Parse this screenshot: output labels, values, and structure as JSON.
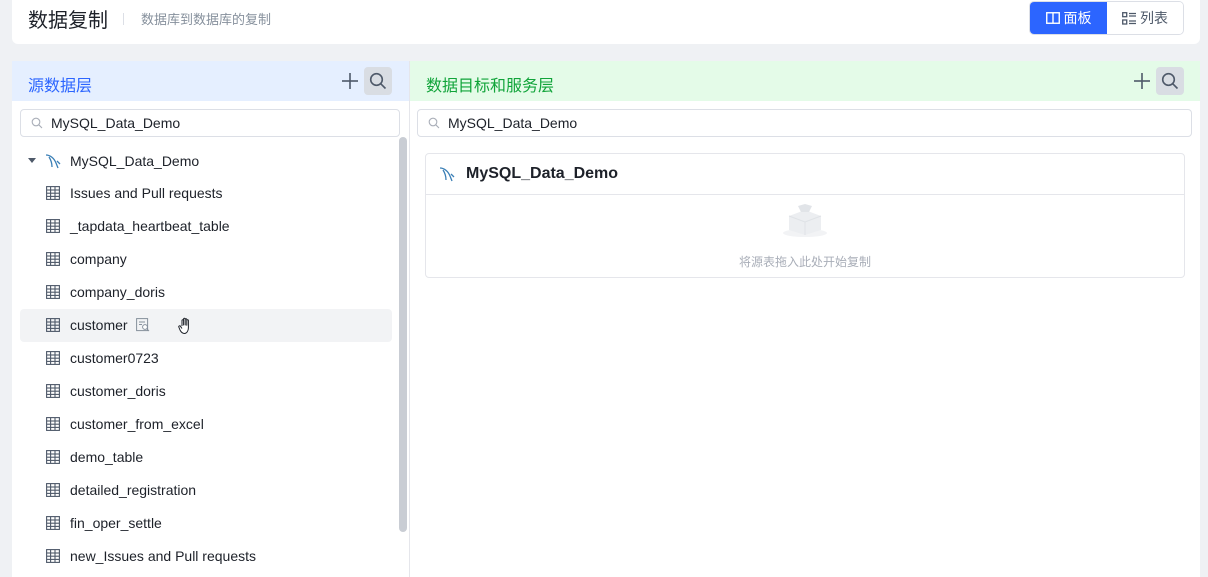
{
  "header": {
    "title": "数据复制",
    "subtitle": "数据库到数据库的复制",
    "view_panel_label": "面板",
    "view_list_label": "列表"
  },
  "source": {
    "title": "源数据层",
    "search_value": "MySQL_Data_Demo",
    "root_label": "MySQL_Data_Demo",
    "items": [
      "Issues and Pull requests",
      "_tapdata_heartbeat_table",
      "company",
      "company_doris",
      "customer",
      "customer0723",
      "customer_doris",
      "customer_from_excel",
      "demo_table",
      "detailed_registration",
      "fin_oper_settle",
      "new_Issues and Pull requests"
    ],
    "hover_index": 4
  },
  "target": {
    "title": "数据目标和服务层",
    "search_value": "MySQL_Data_Demo",
    "card_title": "MySQL_Data_Demo",
    "empty_text": "将源表拖入此处开始复制"
  },
  "colors": {
    "accent": "#2c65ff",
    "source_header_bg": "#e5efff",
    "target_header_bg": "#e4fbe8",
    "target_title": "#11a43a"
  }
}
